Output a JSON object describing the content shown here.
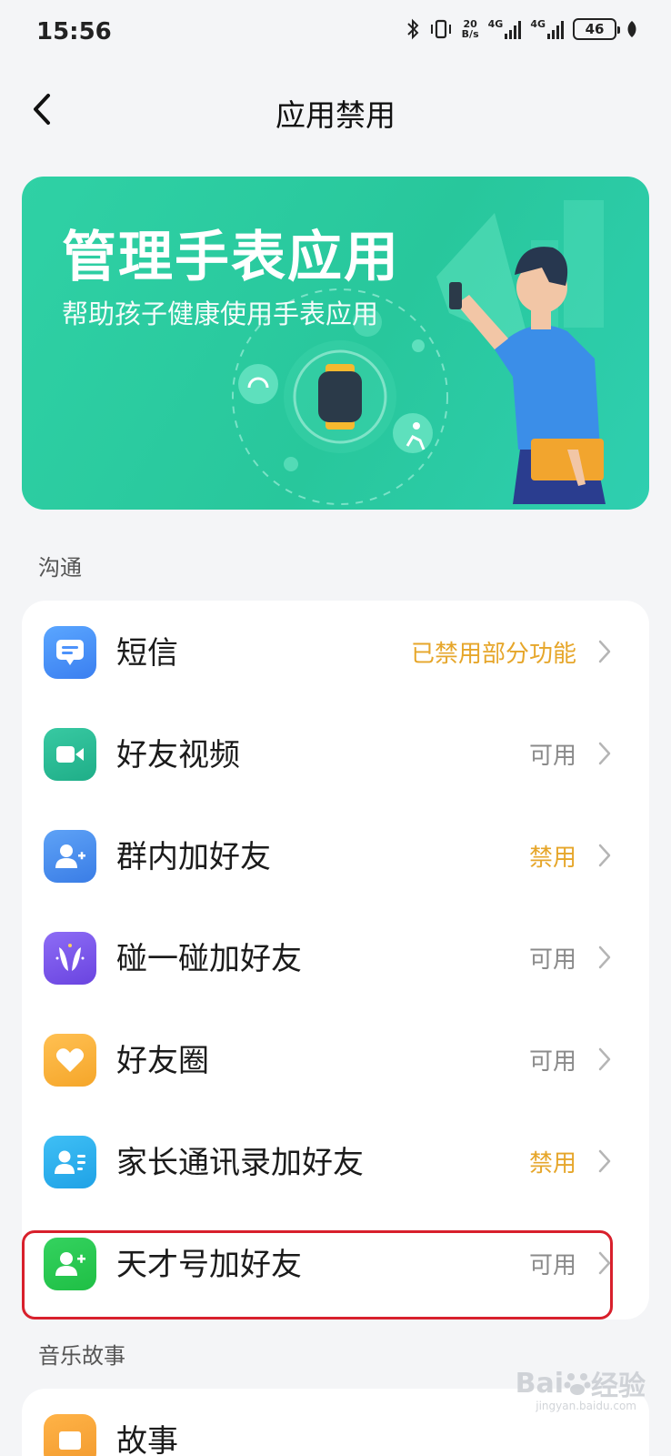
{
  "status_bar": {
    "time": "15:56",
    "speed_top": "20",
    "speed_bottom": "B/s",
    "network_1": "4G",
    "network_2": "4G",
    "battery": "46"
  },
  "header": {
    "title": "应用禁用"
  },
  "banner": {
    "title": "管理手表应用",
    "subtitle": "帮助孩子健康使用手表应用"
  },
  "sections": [
    {
      "title": "沟通",
      "items": [
        {
          "label": "短信",
          "status": "已禁用部分功能",
          "icon": "message-icon",
          "status_color": "#e6a62a"
        },
        {
          "label": "好友视频",
          "status": "可用",
          "icon": "video-icon",
          "status_color": "#8a8a8a"
        },
        {
          "label": "群内加好友",
          "status": "禁用",
          "icon": "add-friend-icon",
          "status_color": "#e6a62a"
        },
        {
          "label": "碰一碰加好友",
          "status": "可用",
          "icon": "bump-icon",
          "status_color": "#8a8a8a"
        },
        {
          "label": "好友圈",
          "status": "可用",
          "icon": "heart-icon",
          "status_color": "#8a8a8a"
        },
        {
          "label": "家长通讯录加好友",
          "status": "禁用",
          "icon": "contacts-icon",
          "status_color": "#e6a62a"
        },
        {
          "label": "天才号加好友",
          "status": "可用",
          "icon": "add-person-icon",
          "status_color": "#8a8a8a"
        }
      ]
    },
    {
      "title": "音乐故事",
      "items": [
        {
          "label": "故事",
          "status": "",
          "icon": "story-icon"
        }
      ]
    }
  ],
  "watermark": {
    "brand": "Bai",
    "brand_end": "经验",
    "url": "jingyan.baidu.com"
  },
  "colors": {
    "accent_green": "#2fd1a5",
    "status_disabled": "#e6a62a",
    "status_enabled": "#8a8a8a",
    "highlight_red": "#d8202c"
  }
}
